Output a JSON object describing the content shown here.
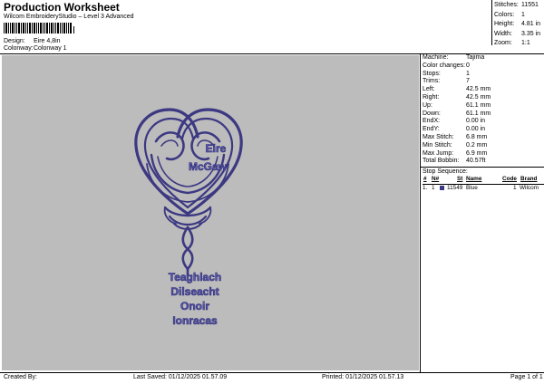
{
  "header": {
    "title": "Production Worksheet",
    "subtitle": "Wilcom EmbroideryStudio – Level 3 Advanced",
    "design_label": "Design:",
    "design_value": "Eire 4,8in",
    "colorway_label": "Colonway:",
    "colorway_value": "Colonway 1"
  },
  "stats": [
    {
      "label": "Stitches:",
      "value": "11551"
    },
    {
      "label": "Colors:",
      "value": "1"
    },
    {
      "label": "Height:",
      "value": "4.81 in"
    },
    {
      "label": "Width:",
      "value": "3.35 in"
    },
    {
      "label": "Zoom:",
      "value": "1:1"
    }
  ],
  "machine_info": [
    {
      "label": "Machine:",
      "value": "Tajima"
    },
    {
      "label": "Color changes:",
      "value": "0"
    },
    {
      "label": "Stops:",
      "value": "1"
    },
    {
      "label": "Trims:",
      "value": "7"
    },
    {
      "label": "Left:",
      "value": "42.5 mm"
    },
    {
      "label": "Right:",
      "value": "42.5 mm"
    },
    {
      "label": "Up:",
      "value": "61.1 mm"
    },
    {
      "label": "Down:",
      "value": "61.1 mm"
    },
    {
      "label": "EndX:",
      "value": "0.00 in"
    },
    {
      "label": "EndY:",
      "value": "0.00 in"
    },
    {
      "label": "Max Stitch:",
      "value": "6.8 mm"
    },
    {
      "label": "Min Stitch:",
      "value": "0.2 mm"
    },
    {
      "label": "Max Jump:",
      "value": "6.9 mm"
    },
    {
      "label": "Total Bobbin:",
      "value": "40.57ft"
    }
  ],
  "stop_sequence": {
    "title": "Stop Sequence:",
    "headers": [
      "#",
      "N#",
      "",
      "St",
      "Name",
      "Code",
      "Brand"
    ],
    "rows": [
      {
        "num": "1.",
        "n": "1",
        "stitches": "11549",
        "name": "Blue",
        "code": "1",
        "brand": "Wilcom"
      }
    ]
  },
  "design_text": {
    "line1": "Eire",
    "line2": "McGaw",
    "line3": "Teaghlach",
    "line4": "Dilseacht",
    "line5": "Onoir",
    "line6": "Ionracas"
  },
  "footer": {
    "created_by": "Created By:",
    "last_saved": "Last Saved: 01/12/2025 01.57.09",
    "printed": "Printed: 01/12/2025 01.57.13",
    "page": "Page 1 of 1"
  },
  "colors": {
    "canvas": "#bcbcbc",
    "thread": "#3c3882"
  }
}
